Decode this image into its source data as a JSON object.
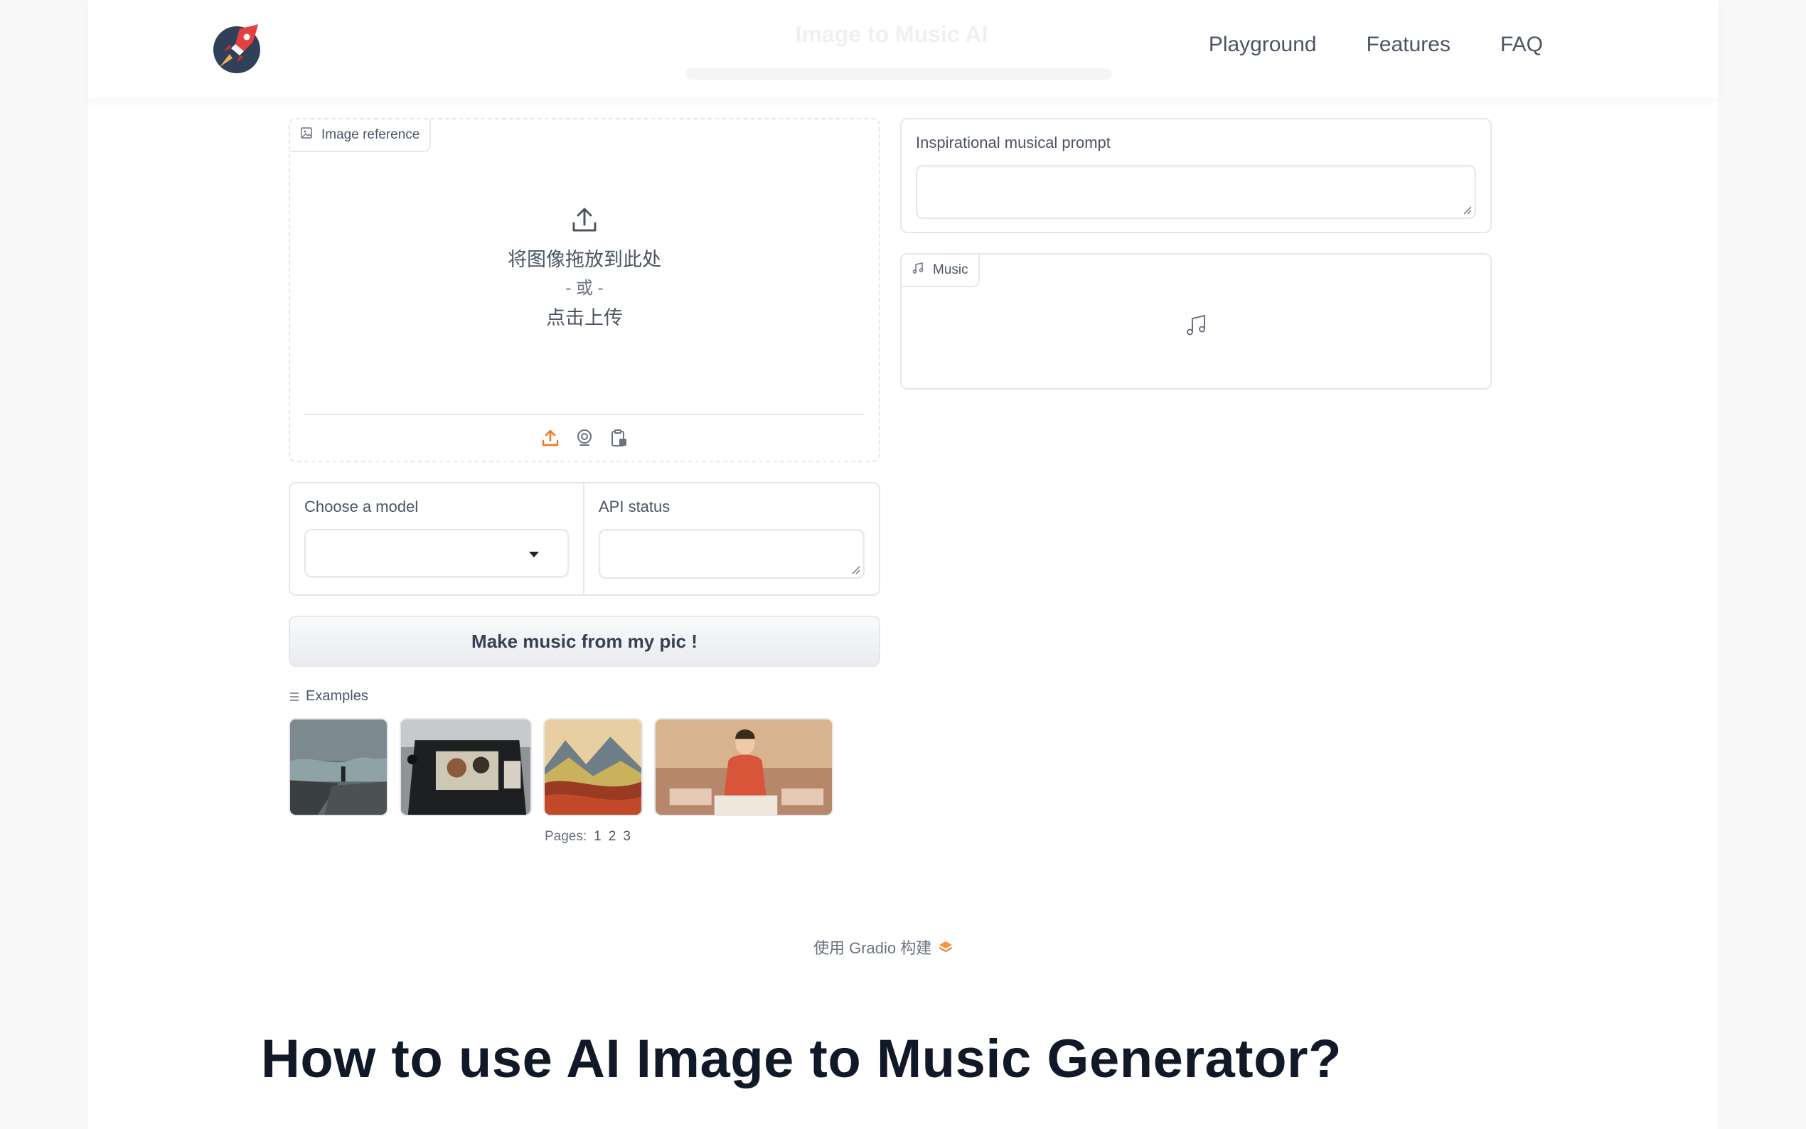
{
  "header": {
    "title": "Image to Music AI",
    "nav": [
      "Playground",
      "Features",
      "FAQ"
    ]
  },
  "image_reference": {
    "label": "Image reference",
    "drop_text": "将图像拖放到此处",
    "or_text": "- 或 -",
    "click_text": "点击上传"
  },
  "model": {
    "label": "Choose a model",
    "selected": ""
  },
  "api_status": {
    "label": "API status",
    "value": ""
  },
  "generate_button": "Make music from my pic !",
  "examples": {
    "label": "Examples",
    "pages_label": "Pages:",
    "pages": [
      "1",
      "2",
      "3"
    ]
  },
  "prompt": {
    "label": "Inspirational musical prompt",
    "value": ""
  },
  "music": {
    "label": "Music"
  },
  "footer": {
    "built_with": "使用 Gradio 构建"
  },
  "section_heading": "How to use AI Image to Music Generator?",
  "colors": {
    "accent": "#f97316",
    "border": "#e5e7eb",
    "text": "#374151"
  }
}
